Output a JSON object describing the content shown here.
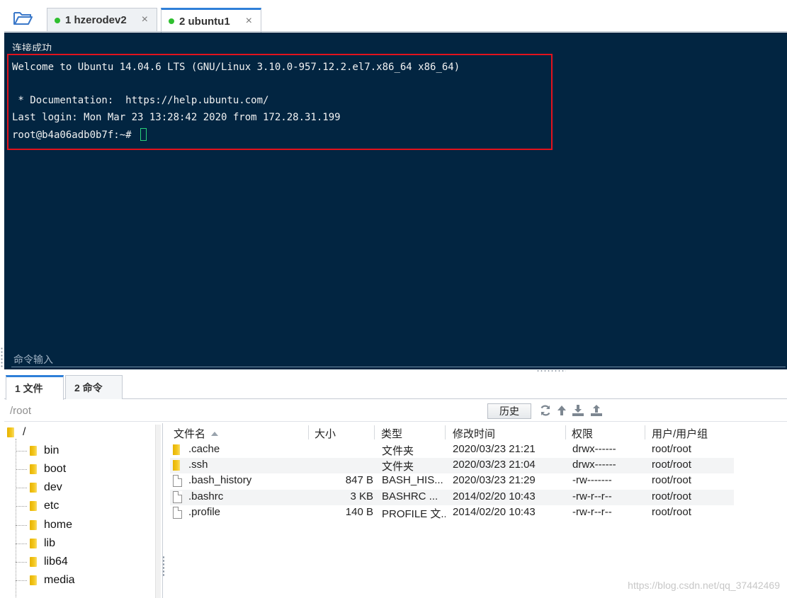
{
  "session_tabs": [
    {
      "label": "1 hzerodev2",
      "close": "×"
    },
    {
      "label": "2 ubuntu1",
      "close": "×"
    }
  ],
  "terminal": {
    "status_text": "连接成功",
    "lines": [
      "Welcome to Ubuntu 14.04.6 LTS (GNU/Linux 3.10.0-957.12.2.el7.x86_64 x86_64)",
      "",
      " * Documentation:  https://help.ubuntu.com/",
      "Last login: Mon Mar 23 13:28:42 2020 from 172.28.31.199",
      "root@b4a06adb0b7f:~# "
    ],
    "command_input_label": "命令输入",
    "highlight_color": "#e3121c",
    "background": "#022541"
  },
  "panel_tabs": [
    {
      "label": "1 文件"
    },
    {
      "label": "2 命令"
    }
  ],
  "path_bar": {
    "path": "/root",
    "history_label": "历史",
    "icons": [
      "refresh-icon",
      "up-directory-icon",
      "download-icon",
      "upload-icon"
    ]
  },
  "tree": {
    "root": "/",
    "items": [
      "bin",
      "boot",
      "dev",
      "etc",
      "home",
      "lib",
      "lib64",
      "media"
    ]
  },
  "file_list": {
    "columns": [
      "文件名",
      "大小",
      "类型",
      "修改时间",
      "权限",
      "用户/用户组"
    ],
    "rows": [
      {
        "name": ".cache",
        "size": "",
        "type": "文件夹",
        "modified": "2020/03/23 21:21",
        "perm": "drwx------",
        "owner": "root/root",
        "icon": "folder-icon"
      },
      {
        "name": ".ssh",
        "size": "",
        "type": "文件夹",
        "modified": "2020/03/23 21:04",
        "perm": "drwx------",
        "owner": "root/root",
        "icon": "folder-icon"
      },
      {
        "name": ".bash_history",
        "size": "847 B",
        "type": "BASH_HIS...",
        "modified": "2020/03/23 21:29",
        "perm": "-rw-------",
        "owner": "root/root",
        "icon": "file-icon"
      },
      {
        "name": ".bashrc",
        "size": "3 KB",
        "type": "BASHRC ...",
        "modified": "2014/02/20 10:43",
        "perm": "-rw-r--r--",
        "owner": "root/root",
        "icon": "file-icon"
      },
      {
        "name": ".profile",
        "size": "140 B",
        "type": "PROFILE 文...",
        "modified": "2014/02/20 10:43",
        "perm": "-rw-r--r--",
        "owner": "root/root",
        "icon": "file-icon"
      }
    ]
  },
  "watermark": "https://blog.csdn.net/qq_37442469"
}
